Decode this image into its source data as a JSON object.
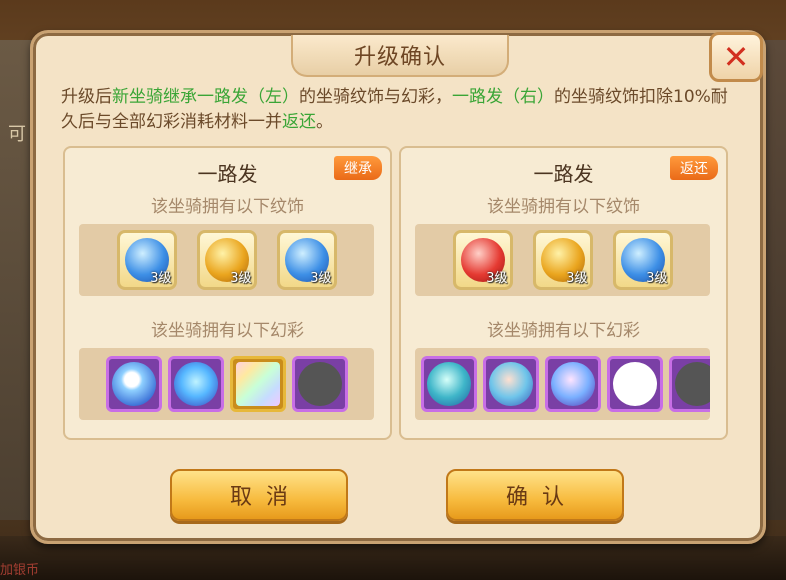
{
  "background": {
    "left_text": "可",
    "bottom_text": "加银币"
  },
  "dialog": {
    "title": "升级确认",
    "close_icon": "close-x-icon"
  },
  "description": {
    "p1": "升级后",
    "p2": "新坐骑继承一路发（左）",
    "p3": "的坐骑纹饰与幻彩，",
    "p4": "一路发（右）",
    "p5": "的坐骑纹饰扣除10%耐久后与全部幻彩消耗材料一并",
    "p6": "返还",
    "p7": "。"
  },
  "colors": {
    "highlight_green": "#3aa536",
    "tag_orange": "#ea6a18",
    "text_brown": "#6b4a2a"
  },
  "left_panel": {
    "name": "一路发",
    "tag": "继承",
    "ornaments_label": "该坐骑拥有以下纹饰",
    "ornaments": [
      {
        "icon": "blue-ornament-icon",
        "level": "3级"
      },
      {
        "icon": "gold-ornament-icon",
        "level": "3级"
      },
      {
        "icon": "blue-ornament-icon",
        "level": "3级"
      }
    ],
    "skins_label": "该坐骑拥有以下幻彩",
    "skins": [
      "ghost-skin-icon",
      "heart-wave-skin-icon",
      "rainbow-skin-icon",
      "empty-skin-icon"
    ]
  },
  "right_panel": {
    "name": "一路发",
    "tag": "返还",
    "ornaments_label": "该坐骑拥有以下纹饰",
    "ornaments": [
      {
        "icon": "red-ornament-icon",
        "level": "3级"
      },
      {
        "icon": "gold-ornament-icon",
        "level": "3级"
      },
      {
        "icon": "blue-ornament-icon",
        "level": "3级"
      }
    ],
    "skins_label": "该坐骑拥有以下幻彩",
    "skins": [
      "leaf-skin-icon",
      "flower-skin-icon",
      "gift-skin-icon",
      "white-skin-icon",
      "empty-skin-icon"
    ]
  },
  "buttons": {
    "cancel": "取消",
    "confirm": "确认"
  }
}
